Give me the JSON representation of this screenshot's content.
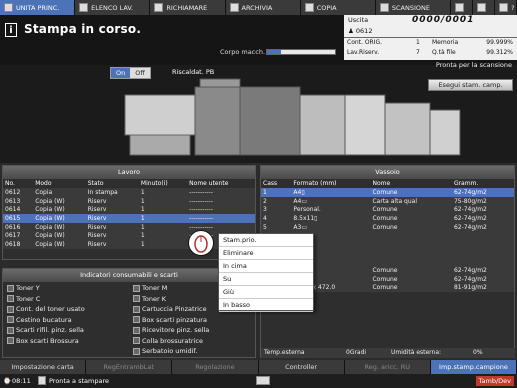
{
  "tabs": [
    {
      "label": "UNITA PRINC.",
      "active": true,
      "icon": "printer-icon"
    },
    {
      "label": "ELENCO LAV.",
      "icon": "list-icon"
    },
    {
      "label": "RICHIAMARE",
      "icon": "recall-icon"
    },
    {
      "label": "ARCHIVIA",
      "icon": "archive-icon"
    },
    {
      "label": "COPIA",
      "icon": "copy-icon"
    },
    {
      "label": "SCANSIONE",
      "icon": "scan-icon"
    },
    {
      "label": "",
      "icon": "settings-icon"
    },
    {
      "label": "",
      "icon": "globe-icon"
    },
    {
      "label": "?",
      "icon": "help-icon"
    }
  ],
  "header": {
    "title": "Stampa in corso.",
    "info_icon": "i",
    "corpo_label": "Corpo macch.",
    "corpo_level": 0.2,
    "pronta_scan": "Pronta per la scansione"
  },
  "status": {
    "uscita_label": "Uscita",
    "counter": "0000/0001",
    "user": "0612",
    "cont_orig_label": "Cont. ORIG.",
    "cont_orig_value": "1",
    "memoria_label": "Memoria",
    "memoria_value": "99.999%",
    "lav_riserv_label": "Lav.Riserv.",
    "lav_riserv_value": "7",
    "qta_file_label": "Q.tà file",
    "qta_file_value": "99.312%"
  },
  "machine": {
    "on_label": "On",
    "off_label": "Off",
    "riscaldat": "Riscaldat. PB",
    "esegui": "Esegui stam. camp."
  },
  "lavoro": {
    "title": "Lavoro",
    "columns": [
      "No.",
      "Modo",
      "Stato",
      "Minuto(i)",
      "Nome utente"
    ],
    "rows": [
      [
        "0612",
        "Copia",
        "In stampa",
        "1",
        "-----------"
      ],
      [
        "0613",
        "Copia (W)",
        "Riserv",
        "1",
        "-----------"
      ],
      [
        "0614",
        "Copia (W)",
        "Riserv",
        "1",
        "-----------"
      ],
      [
        "0615",
        "Copia (W)",
        "Riserv",
        "1",
        "-----------"
      ],
      [
        "0616",
        "Copia (W)",
        "Riserv",
        "1",
        "-----------"
      ],
      [
        "0617",
        "Copia (W)",
        "Riserv",
        "1",
        "-----------"
      ],
      [
        "0618",
        "Copia (W)",
        "Riserv",
        "1",
        "-----------"
      ]
    ],
    "selected_row": 3
  },
  "vassoio": {
    "title": "Vassoio",
    "columns": [
      "Cass",
      "Formato (mm)",
      "Nome",
      "Gramm."
    ],
    "rows": [
      [
        "1",
        "A4▯",
        "Comune",
        "62-74g/m2"
      ],
      [
        "2",
        "A4▭",
        "Carta alta qual",
        "75-80g/m2"
      ],
      [
        "3",
        "Personal.",
        "Comune",
        "62-74g/m2"
      ],
      [
        "4",
        "8.5x11▯",
        "Comune",
        "62-74g/m2"
      ],
      [
        "5",
        "A3▭",
        "Comune",
        "62-74g/m2"
      ],
      [
        "",
        "",
        "",
        ""
      ],
      [
        "",
        "",
        "",
        ""
      ],
      [
        "",
        "",
        "",
        ""
      ],
      [
        "",
        "",
        "",
        ""
      ],
      [
        "",
        "A4▭",
        "Comune",
        "62-74g/m2"
      ],
      [
        "",
        "A4▭",
        "Comune",
        "62-74g/m2"
      ],
      [
        "PB",
        "307.0 x 472.0",
        "Comune",
        "81-91g/m2"
      ]
    ],
    "selected_row": 0,
    "temp_label": "Temp.esterna",
    "temp_value": "0Gradi",
    "umid_label": "Umidità esterna:",
    "umid_value": "0%"
  },
  "consumabili": {
    "title": "Indicatori consumabili e scarti",
    "left": [
      "Toner Y",
      "Toner C",
      "Cont. del toner usato",
      "Cestino bucatura",
      "Scarti rifil. pinz. sella",
      "Box scarti Brossura"
    ],
    "right": [
      "Toner M",
      "Toner K",
      "Cartuccia Pinzatrice",
      "Box scarti pinzatura",
      "Ricevitore pinz. sella",
      "Colla brossuratrice",
      "Serbatoio umidif."
    ]
  },
  "context_menu": [
    "Stam.prio.",
    "Eliminare",
    "In cima",
    "Su",
    "Giù",
    "In basso"
  ],
  "footer": [
    {
      "label": "Impostazione carta",
      "state": "normal"
    },
    {
      "label": "RegEntrambLat",
      "state": "dim"
    },
    {
      "label": "Regolazione",
      "state": "dim"
    },
    {
      "label": "Controller",
      "state": "normal"
    },
    {
      "label": "Reg. aricc. RU",
      "state": "dim"
    },
    {
      "label": "Imp.stamp.campione",
      "state": "normal"
    }
  ],
  "statusbar": {
    "time": "08:11",
    "message": "Pronta a stampare",
    "right": "Tamb/Dev"
  },
  "colors": {
    "accent": "#4c72b8"
  }
}
